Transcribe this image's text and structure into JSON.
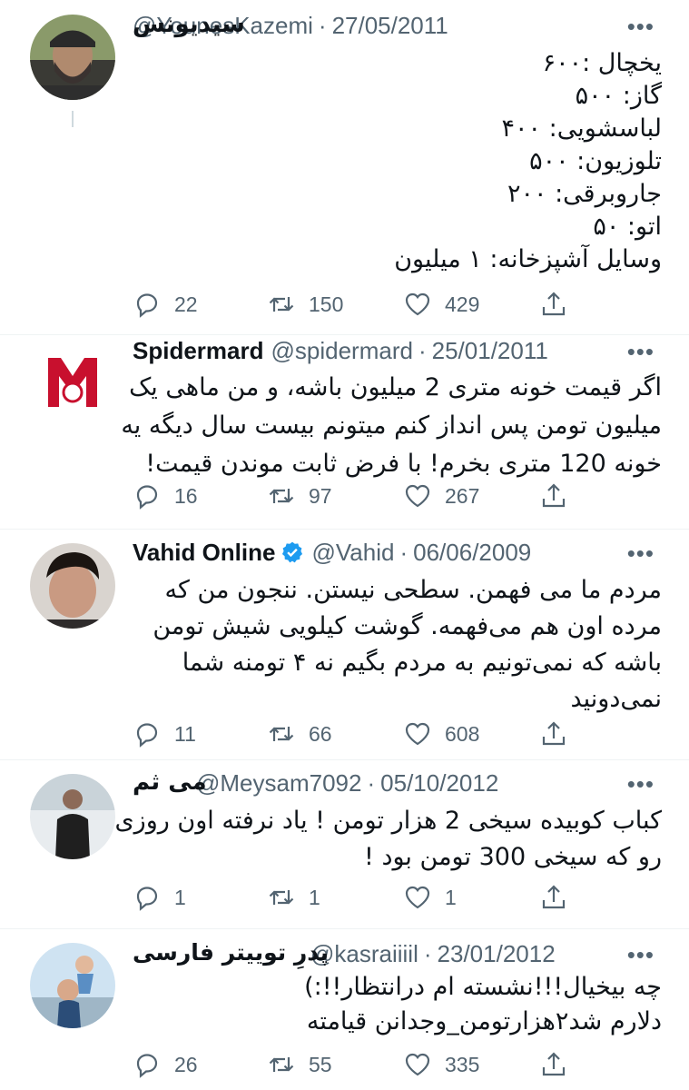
{
  "tweets": [
    {
      "name": "سیدیونس",
      "handle": "@YounesKazemi",
      "date": "27/05/2011",
      "lines": [
        "یخچال :۶۰۰",
        "گاز: ۵۰۰",
        "لباسشویی: ۴۰۰",
        "تلوزیون: ۵۰۰",
        "جاروبرقی: ۲۰۰",
        "اتو: ۵۰",
        "وسایل آشپزخانه: ۱ میلیون"
      ],
      "replies": "22",
      "retweets": "150",
      "likes": "429"
    },
    {
      "name": "Spidermard",
      "handle": "@spidermard",
      "date": "25/01/2011",
      "lines": [
        "اگر قیمت خونه متری 2 میلیون باشه، و من ماهی یک",
        "میلیون تومن پس انداز کنم میتونم بیست سال دیگه یه",
        "خونه 120 متری بخرم! با فرض ثابت موندن قیمت!"
      ],
      "replies": "16",
      "retweets": "97",
      "likes": "267"
    },
    {
      "name": "Vahid Online",
      "handle": "@Vahid",
      "date": "06/06/2009",
      "verified": true,
      "lines": [
        "مردم ما می فهمن. سطحی نیستن. ننجون من که",
        "مرده اون هم می‌فهمه. گوشت کیلویی شیش تومن",
        "باشه که نمی‌تونیم به مردم بگیم نه ۴ تومنه شما",
        "نمی‌دونید"
      ],
      "replies": "11",
      "retweets": "66",
      "likes": "608"
    },
    {
      "name": "می ثم",
      "handle": "@Meysam7092",
      "date": "05/10/2012",
      "lines": [
        "کباب کوبیده سیخی 2 هزار تومن ! یاد نرفته اون روزی",
        "رو که سیخی 300 تومن بود !"
      ],
      "replies": "1",
      "retweets": "1",
      "likes": "1"
    },
    {
      "name": "پدرِ توییتر فارسی",
      "handle": "@kasraiiiil",
      "date": "23/01/2012",
      "lines": [
        "چه بیخیال!!!نشسته ام درانتظار!!:)",
        "دلارم شد۲هزارتومن_وجدانن قیامته"
      ],
      "replies": "26",
      "retweets": "55",
      "likes": "335"
    }
  ],
  "ui": {
    "more": "•••",
    "sep": "·",
    "accent": "#1d9bf0",
    "icons": [
      "reply-icon",
      "retweet-icon",
      "like-icon",
      "share-icon",
      "verified-badge-icon"
    ]
  }
}
